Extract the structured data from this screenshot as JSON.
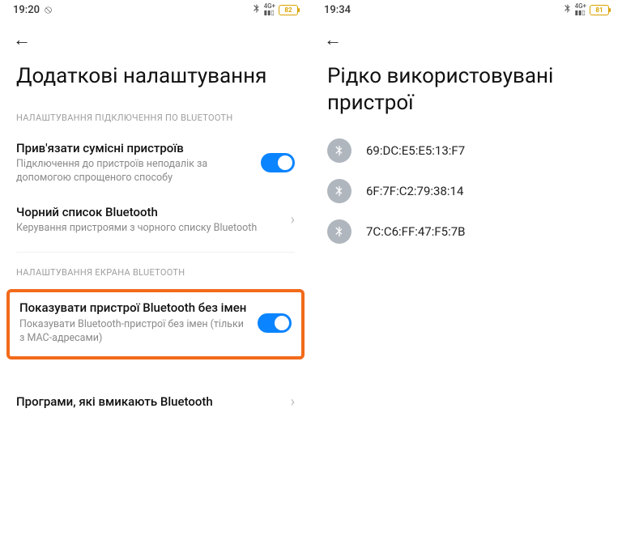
{
  "left": {
    "status": {
      "time": "19:20",
      "battery": "82"
    },
    "title": "Додаткові налаштування",
    "section1": "НАЛАШТУВАННЯ ПІДКЛЮЧЕННЯ ПО BLUETOOTH",
    "pair": {
      "title": "Прив'язати сумісні пристроїв",
      "sub": "Підключення до пристроїв неподалік за допомогою спрощеного способу"
    },
    "blacklist": {
      "title": "Чорний список Bluetooth",
      "sub": "Керування пристроями з чорного списку Bluetooth"
    },
    "section2": "НАЛАШТУВАННЯ ЕКРАНА BLUETOOTH",
    "noname": {
      "title": "Показувати пристрої Bluetooth без імен",
      "sub": "Показувати Bluetooth-пристрої без імен (тільки з MAC-адресами)"
    },
    "apps": {
      "title": "Програми, які вмикають Bluetooth"
    }
  },
  "right": {
    "status": {
      "time": "19:34",
      "battery": "81"
    },
    "title": "Рідко використовувані пристрої",
    "devices": {
      "d0": "69:DC:E5:E5:13:F7",
      "d1": "6F:7F:C2:79:38:14",
      "d2": "7C:C6:FF:47:F5:7B"
    }
  }
}
